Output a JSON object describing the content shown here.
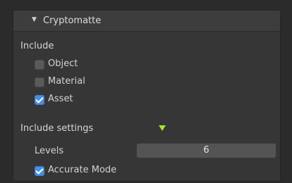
{
  "panel": {
    "title": "Cryptomatte",
    "collapse_icon": "triangle-down-icon"
  },
  "include": {
    "label": "Include",
    "options": [
      {
        "label": "Object",
        "checked": false
      },
      {
        "label": "Material",
        "checked": false
      },
      {
        "label": "Asset",
        "checked": true
      }
    ]
  },
  "include_settings": {
    "label": "Include settings",
    "marker_icon": "green-triangle-down-icon",
    "marker_color": "#a6e22e",
    "levels": {
      "label": "Levels",
      "value": "6"
    },
    "accurate_mode": {
      "label": "Accurate Mode",
      "checked": true
    }
  },
  "colors": {
    "checkbox_checked": "#4a8fe0",
    "checkbox_unchecked": "#5a5a5a",
    "panel_bg": "#363636",
    "header_bg": "#3d3d3d"
  }
}
